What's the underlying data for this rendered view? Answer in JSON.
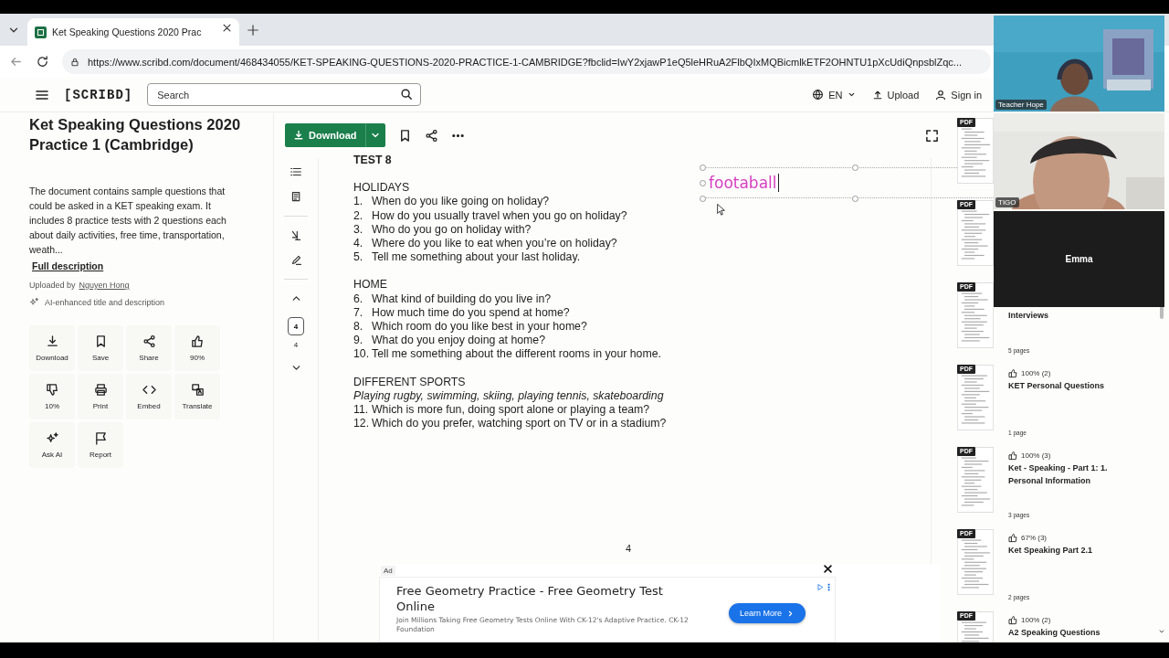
{
  "browser": {
    "tab_title": "Ket Speaking Questions 2020 Prac",
    "url": "https://www.scribd.com/document/468434055/KET-SPEAKING-QUESTIONS-2020-PRACTICE-1-CAMBRIDGE?fbclid=IwY2xjawP1eQ5leHRuA2FlbQIxMQBicmlkETF2OHNTU1pXcUdiQnpsblZqc..."
  },
  "header": {
    "logo": "[SCRIBD]",
    "search": {
      "placeholder": "Search"
    },
    "language": "EN",
    "upload": "Upload",
    "sign_in": "Sign in"
  },
  "document": {
    "title": "Ket Speaking Questions 2020 Practice 1 (Cambridge)",
    "description": "The document contains sample questions that could be asked in a KET speaking exam. It includes 8 practice tests with 2 questions each about daily activities, free time, transportation, weath...",
    "full_description": "Full description",
    "uploaded_by": "Uploaded by",
    "uploader": "Nguyen Hong",
    "ai_note": "AI-enhanced title and description"
  },
  "actions": [
    {
      "kind": "download",
      "label": "Download"
    },
    {
      "kind": "save",
      "label": "Save"
    },
    {
      "kind": "share",
      "label": "Share"
    },
    {
      "kind": "like",
      "label": "90%"
    },
    {
      "kind": "dislike",
      "label": "10%"
    },
    {
      "kind": "print",
      "label": "Print"
    },
    {
      "kind": "embed",
      "label": "Embed"
    },
    {
      "kind": "translate",
      "label": "Translate"
    },
    {
      "kind": "ask_ai",
      "label": "Ask AI"
    },
    {
      "kind": "report",
      "label": "Report"
    }
  ],
  "toolbar": {
    "download": "Download"
  },
  "page_nav": {
    "current": "4",
    "total": "4"
  },
  "page": {
    "lines": [
      {
        "kind": "title",
        "text": "TEST 8"
      },
      {
        "kind": "heading",
        "text": "HOLIDAYS"
      },
      {
        "kind": "item",
        "num": "1.",
        "text": "When do you like going on holiday?"
      },
      {
        "kind": "item",
        "num": "2.",
        "text": "How do you usually travel when you go on holiday?"
      },
      {
        "kind": "item",
        "num": "3.",
        "text": "Who do you go on holiday with?"
      },
      {
        "kind": "item",
        "num": "4.",
        "text": "Where do you like to eat when you’re on holiday?"
      },
      {
        "kind": "item",
        "num": "5.",
        "text": "Tell me something about your last holiday."
      },
      {
        "kind": "heading",
        "text": "HOME"
      },
      {
        "kind": "item",
        "num": "6.",
        "text": "What kind of building do you live in?"
      },
      {
        "kind": "item",
        "num": "7.",
        "text": "How much time do you spend at home?"
      },
      {
        "kind": "item",
        "num": "8.",
        "text": "Which room do you like best in your home?"
      },
      {
        "kind": "item",
        "num": "9.",
        "text": "What do you enjoy doing at home?"
      },
      {
        "kind": "item",
        "num": "10.",
        "text": "Tell me something about the different rooms in your home."
      },
      {
        "kind": "heading",
        "text": "DIFFERENT SPORTS"
      },
      {
        "kind": "italic",
        "text": "Playing rugby, swimming, skiing, playing tennis, skateboarding"
      },
      {
        "kind": "item",
        "num": "11.",
        "text": "Which is more fun, doing sport alone or playing a team?"
      },
      {
        "kind": "item",
        "num": "12.",
        "text": "Which do you prefer, watching sport on TV or in a stadium?"
      }
    ],
    "page_number": "4"
  },
  "annotation": {
    "text": "footaball"
  },
  "ad": {
    "label": "Ad",
    "title": "Free Geometry Practice - Free Geometry Test Online",
    "description": "Join Millions Taking Free Geometry Tests Online With CK-12's Adaptive Practice. CK-12 Foundation",
    "button": "Learn More"
  },
  "sidebar": {
    "items": [
      {
        "badge": "PDF"
      },
      {
        "badge": "PDF"
      },
      {
        "badge": "PDF",
        "title": "Interviews",
        "pages": "5 pages"
      },
      {
        "badge": "PDF",
        "rating": "100% (2)",
        "title": "KET Personal Questions",
        "pages": "1 page"
      },
      {
        "badge": "PDF",
        "rating": "100% (3)",
        "title": "Ket - Speaking - Part 1: 1. Personal Information",
        "pages": "3 pages"
      },
      {
        "badge": "PDF",
        "rating": "67% (3)",
        "title": "Ket Speaking Part 2.1",
        "pages": "2 pages"
      },
      {
        "badge": "PDF",
        "rating": "100% (2)",
        "title": "A2 Speaking Questions"
      }
    ]
  },
  "video_call": {
    "tiles": [
      {
        "kind": "camera",
        "name": "Teacher Hope"
      },
      {
        "kind": "camera",
        "name": "TIGO"
      },
      {
        "kind": "off",
        "name": "Emma"
      }
    ]
  }
}
